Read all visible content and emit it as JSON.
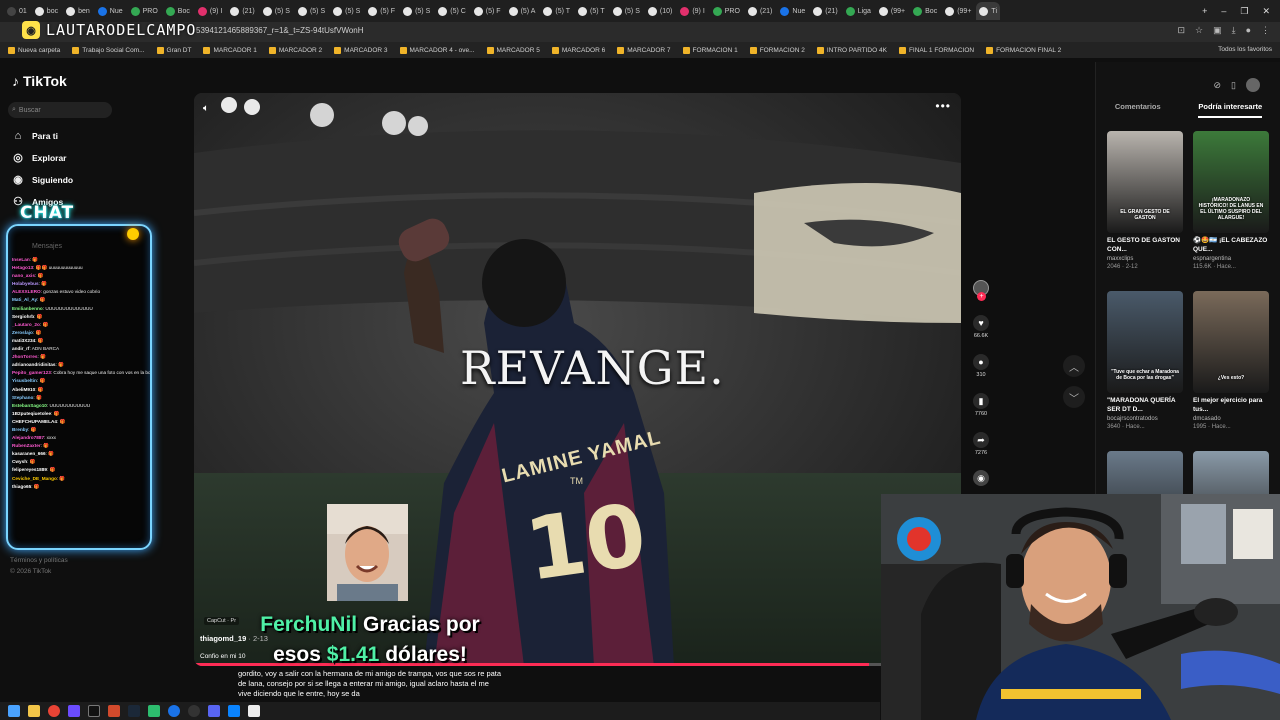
{
  "browser": {
    "tabs": [
      {
        "label": "01",
        "color": "#444"
      },
      {
        "label": "boc",
        "color": "#e6e6e6"
      },
      {
        "label": "ben",
        "color": "#e6e6e6"
      },
      {
        "label": "Nue",
        "color": "#1a73e8"
      },
      {
        "label": "PRO",
        "color": "#34a853"
      },
      {
        "label": "Boc",
        "color": "#34a853"
      },
      {
        "label": "(9) I",
        "color": "#e1306c"
      },
      {
        "label": "(21)",
        "color": "#e6e6e6"
      },
      {
        "label": "(5) S",
        "color": "#e6e6e6"
      },
      {
        "label": "(5) S",
        "color": "#e6e6e6"
      },
      {
        "label": "(5) S",
        "color": "#e6e6e6"
      },
      {
        "label": "(5) F",
        "color": "#e6e6e6"
      },
      {
        "label": "(5) S",
        "color": "#e6e6e6"
      },
      {
        "label": "(5) C",
        "color": "#e6e6e6"
      },
      {
        "label": "(5) F",
        "color": "#e6e6e6"
      },
      {
        "label": "(5) A",
        "color": "#e6e6e6"
      },
      {
        "label": "(5) T",
        "color": "#e6e6e6"
      },
      {
        "label": "(5) T",
        "color": "#e6e6e6"
      },
      {
        "label": "(5) S",
        "color": "#e6e6e6"
      },
      {
        "label": "(10)",
        "color": "#e6e6e6"
      },
      {
        "label": "(9) I",
        "color": "#e1306c"
      },
      {
        "label": "PRO",
        "color": "#34a853"
      },
      {
        "label": "(21)",
        "color": "#e6e6e6"
      },
      {
        "label": "Nue",
        "color": "#1a73e8"
      },
      {
        "label": "(21)",
        "color": "#e6e6e6"
      },
      {
        "label": "Liga",
        "color": "#34a853"
      },
      {
        "label": "(99+",
        "color": "#e6e6e6"
      },
      {
        "label": "Boc",
        "color": "#34a853"
      },
      {
        "label": "(99+",
        "color": "#e6e6e6"
      },
      {
        "label": "Ti",
        "color": "#e6e6e6"
      }
    ],
    "url": "53941214658893​67_r=1&_t=ZS-94tUsfVWonH",
    "bookmarks": [
      "Nueva carpeta",
      "Trabajo Social Com...",
      "Gran DT",
      "MARCADOR 1",
      "MARCADOR 2",
      "MARCADOR 3",
      "MARCADOR 4 - ove...",
      "MARCADOR 5",
      "MARCADOR 6",
      "MARCADOR 7",
      "FORMACION 1",
      "FORMACION 2",
      "INTRO PARTIDO 4K",
      "FINAL 1 FORMACION",
      "FORMACION FINAL 2"
    ],
    "bookmarks_right": "Todos los favoritos"
  },
  "overlay": {
    "logo_text": "LAUTARODELCAMPO",
    "chat_title": "CHAT",
    "chat_header": "Mensajes",
    "chat": [
      {
        "user": "InseLan",
        "msg": ": 🎁",
        "color": "#ff5ad1"
      },
      {
        "user": "Hetago13",
        "msg": ": 🎁🎁 uuuuuuuuuuuuu",
        "color": "#ff5ad1"
      },
      {
        "user": "nano_axis",
        "msg": ": 🎁",
        "color": "#ff5ad1"
      },
      {
        "user": "Holabyebus",
        "msg": ": 🎁",
        "color": "#b9f"
      },
      {
        "user": "ALEXXLERO",
        "msg": ": gonzas estuvo video cobrio",
        "color": "#ff5ad1"
      },
      {
        "user": "Mati_Al_Ay",
        "msg": ": 🎁",
        "color": "#8cf"
      },
      {
        "user": "Emilianbenno",
        "msg": ": UUUUUUUUUUUUUU",
        "color": "#8f8"
      },
      {
        "user": "Sergiohrb",
        "msg": ": 🎁",
        "color": "#fff"
      },
      {
        "user": "_Lautaro_2o",
        "msg": ": 🎁",
        "color": "#ff5ad1"
      },
      {
        "user": "Zeroslajo",
        "msg": ": 🎁",
        "color": "#8cf"
      },
      {
        "user": "mati3X234",
        "msg": ": 🎁",
        "color": "#fff"
      },
      {
        "user": "andir_rf",
        "msg": ": ADN BARCA",
        "color": "#fff"
      },
      {
        "user": "JhonTorres",
        "msg": ": 🎁",
        "color": "#ff5ad1"
      },
      {
        "user": "adrianoandridinitas",
        "msg": ": 🎁",
        "color": "#fff"
      },
      {
        "user": "Pepito_gamer123",
        "msg": ": Cobra hoy me saque una foto con vos en la bombonera",
        "color": "#ff5ad1"
      },
      {
        "user": "Yisusbeltin",
        "msg": ": 🎁",
        "color": "#8cf"
      },
      {
        "user": "AbeliM910",
        "msg": ": 🎁",
        "color": "#fff"
      },
      {
        "user": "Stephano",
        "msg": ": 🎁",
        "color": "#8cf"
      },
      {
        "user": "EstebanSago10",
        "msg": ": UUUUUUUUUUUU",
        "color": "#8f8"
      },
      {
        "user": "1B2puteqiuetolee",
        "msg": ": 🎁",
        "color": "#fff"
      },
      {
        "user": "CHEFCHUPAMELA4",
        "msg": ": 🎁",
        "color": "#fff"
      },
      {
        "user": "Brenby",
        "msg": ": 🎁",
        "color": "#8cf"
      },
      {
        "user": "Alejandro7887",
        "msg": ": xxxx",
        "color": "#ff5ad1"
      },
      {
        "user": "RubenZaxter",
        "msg": ": 🎁",
        "color": "#ff5ad1"
      },
      {
        "user": "kasaranen_666",
        "msg": ": 🎁",
        "color": "#fff"
      },
      {
        "user": "Cwysh",
        "msg": ": 🎁",
        "color": "#fff"
      },
      {
        "user": "felipereyes1889",
        "msg": ": 🎁",
        "color": "#fff"
      },
      {
        "user": "Ceviche_DE_Mango",
        "msg": ": 🎁",
        "color": "#fc0"
      },
      {
        "user": "thiago65",
        "msg": ": 🎁",
        "color": "#fff"
      }
    ],
    "donation_user": "FerchuNil",
    "donation_pre": "Gracias por",
    "donation_mid": "esos",
    "donation_amount": "$1.41",
    "donation_post": "dólares!",
    "subtitle": "gordito, voy a salir con la hermana de mi amigo de trampa, vos que sos re pata de lana, consejo por si se llega a enterar mi amigo, igual aclaro hasta el me vive diciendo que le entre, hoy se da"
  },
  "tiktok": {
    "logo": "TikTok",
    "search_placeholder": "Buscar",
    "nav": [
      "Para ti",
      "Explorar",
      "Siguiendo",
      "Amigos"
    ],
    "footer": [
      "Términos y políticas",
      "© 2026 TikTok"
    ],
    "video": {
      "title": "REVANGE.",
      "jersey_name": "LAMINE YAMAL",
      "jersey_tm": "TM",
      "jersey_number": "10",
      "capcut": "CapCut · Pr",
      "author": "thiagomd_19",
      "date": "· 2-13",
      "caption": "Confio en mi 10",
      "progress": 0.88
    },
    "actions": {
      "likes": "66.6K",
      "comments": "310",
      "saves": "7760",
      "shares": "7276"
    },
    "right_panel": {
      "tabs": [
        "Comentarios",
        "Podría interesarte"
      ],
      "active_tab": 1,
      "cards": [
        {
          "caption": "EL GESTO DE GASTON CON...",
          "author": "maxxclips",
          "views": "2046",
          "date": "· 2-12",
          "thumb_text": "EL GRAN GESTO DE GASTON",
          "bg": "#b9b4ae"
        },
        {
          "caption": "⚽🤩🇦🇷 ¡EL CABEZAZO QUE...",
          "author": "espnargentina",
          "views": "115.6K",
          "date": "· Hace...",
          "thumb_text": "¡MARADONAZO HISTÓRICO! DE LANUS EN EL ÚLTIMO SUSPIRO DEL ALARGUE!",
          "bg": "#3c7a3a"
        },
        {
          "caption": "\"MARADONA QUERÍA SER DT D...",
          "author": "bocajrscontratodos",
          "views": "3640",
          "date": "· Hace...",
          "thumb_text": "\"Tuve que echar a Maradona de Boca por las drogas\"",
          "bg": "#4a5a6a"
        },
        {
          "caption": "El mejor ejercicio para tus...",
          "author": "dmcasado",
          "views": "1995",
          "date": "· Hace...",
          "thumb_text": "¿Ves esto?",
          "bg": "#7a6a5a"
        },
        {
          "caption": "",
          "author": "",
          "views": "",
          "date": "",
          "thumb_text": "",
          "bg": "#6a7a8a"
        },
        {
          "caption": "",
          "author": "",
          "views": "",
          "date": "",
          "thumb_text": "",
          "bg": "#8a9aa8"
        }
      ]
    }
  },
  "colors": {
    "accent": "#fe2c55",
    "chat_glow": "#7ad5ff",
    "donation_green": "#4ff0a6"
  }
}
